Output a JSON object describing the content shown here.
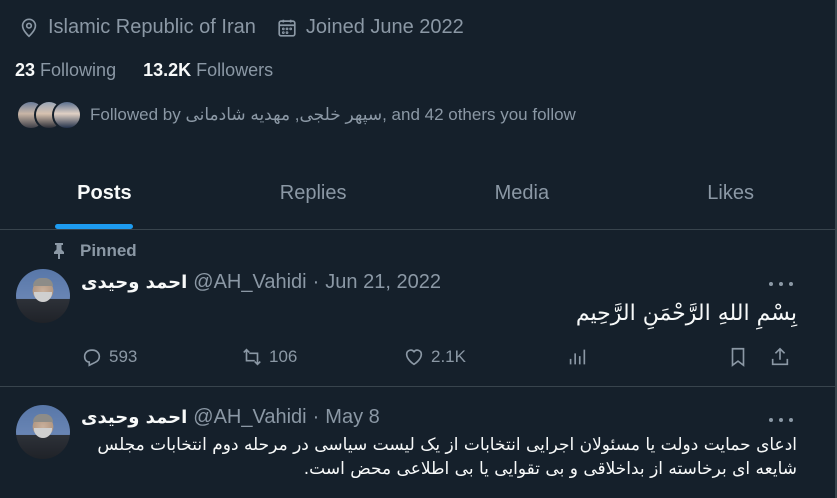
{
  "profile": {
    "location": "Islamic Republic of Iran",
    "joined": "Joined June 2022",
    "following_count": "23",
    "following_label": "Following",
    "followers_count": "13.2K",
    "followers_label": "Followers",
    "followed_by": "Followed by سپهر خلجی, مهدیه شادمانی, and 42 others you follow"
  },
  "tabs": [
    {
      "label": "Posts",
      "active": true
    },
    {
      "label": "Replies",
      "active": false
    },
    {
      "label": "Media",
      "active": false
    },
    {
      "label": "Likes",
      "active": false
    }
  ],
  "tweets": [
    {
      "pinned_label": "Pinned",
      "name": "احمد وحیدی",
      "handle": "@AH_Vahidi",
      "date": "Jun 21, 2022",
      "text": "بِسْمِ اللهِ الرَّحْمَنِ الرَّحِيم",
      "replies": "593",
      "retweets": "106",
      "likes": "2.1K"
    },
    {
      "name": "احمد وحیدی",
      "handle": "@AH_Vahidi",
      "date": "May 8",
      "text": "ادعای حمایت دولت یا مسئولان اجرایی انتخابات از یک لیست سیاسی در مرحله دوم انتخابات مجلس شایعه ای برخاسته از بداخلاقی و بی تقوایی یا بی اطلاعی محض است."
    }
  ],
  "separator": "·",
  "colors": {
    "background": "#15202b",
    "accent": "#1d9bf0",
    "muted": "#8b98a5",
    "text": "#f7f9f9",
    "border": "#38444d"
  }
}
